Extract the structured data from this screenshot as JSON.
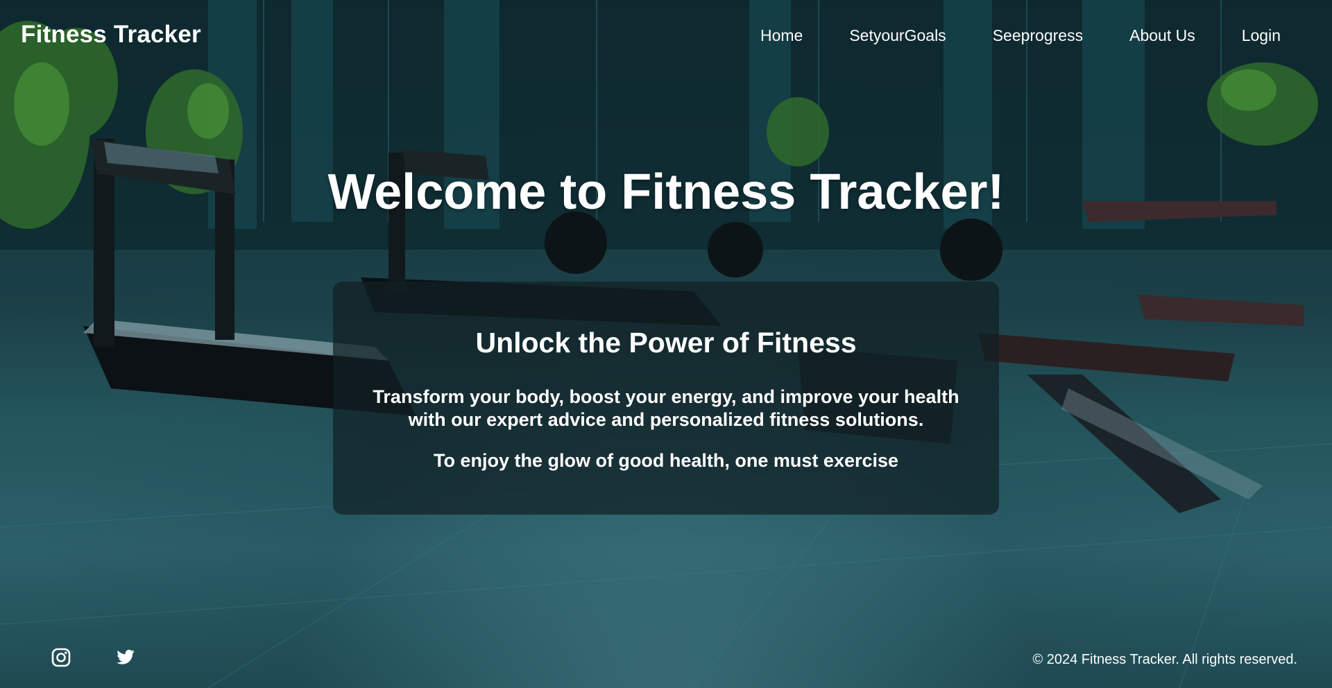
{
  "brand": {
    "name": "Fitness Tracker"
  },
  "nav": {
    "items": [
      {
        "label": "Home"
      },
      {
        "label": "SetyourGoals"
      },
      {
        "label": "Seeprogress"
      },
      {
        "label": "About Us"
      },
      {
        "label": "Login"
      }
    ]
  },
  "hero": {
    "title": "Welcome to Fitness Tracker!",
    "card": {
      "heading": "Unlock the Power of Fitness",
      "text": "Transform your body, boost your energy, and improve your health with our expert advice and personalized fitness solutions.",
      "quote": "To enjoy the glow of good health, one must exercise"
    }
  },
  "footer": {
    "social": [
      {
        "icon": "instagram-icon"
      },
      {
        "icon": "twitter-icon"
      }
    ],
    "copyright": "© 2024 Fitness Tracker. All rights reserved."
  },
  "colors": {
    "text": "#ffffff",
    "card_bg": "#102024",
    "background": "#163a41"
  }
}
